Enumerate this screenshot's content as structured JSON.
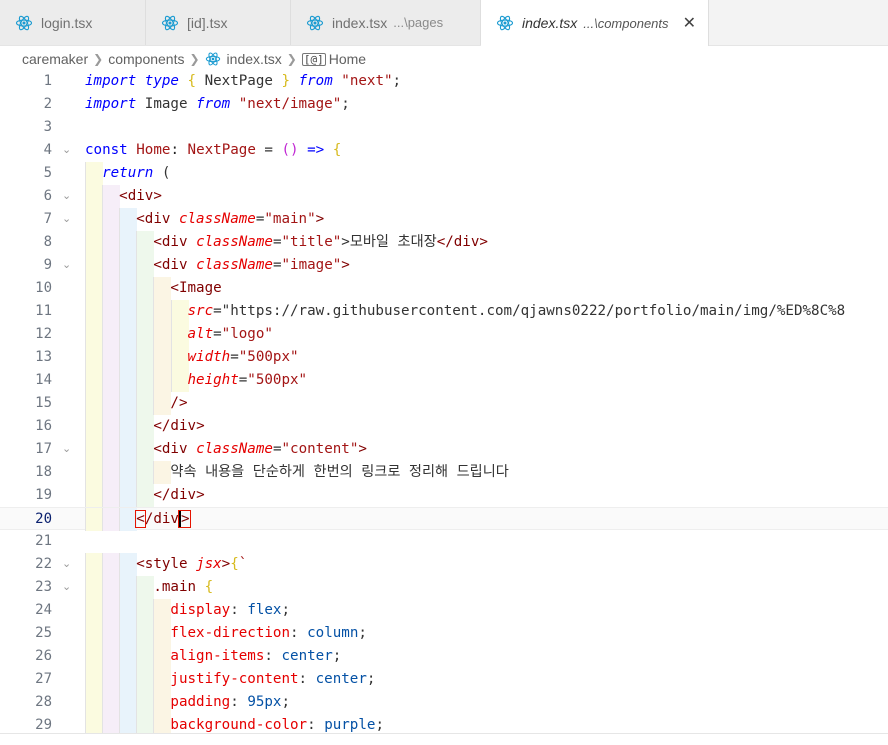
{
  "tabs": [
    {
      "name": "login.tsx",
      "hint": ""
    },
    {
      "name": "[id].tsx",
      "hint": ""
    },
    {
      "name": "index.tsx",
      "hint": "...\\pages"
    },
    {
      "name": "index.tsx",
      "hint": "...\\components",
      "active": true
    }
  ],
  "breadcrumb": {
    "items": [
      "caremaker",
      "components",
      "index.tsx",
      "Home"
    ]
  },
  "icons": {
    "tab_file_icon": "react-icon",
    "breadcrumb_symbol_icon": "symbol-variable-icon",
    "close": "close-icon"
  },
  "colors": {
    "keyword": "#0000ff",
    "string": "#a31515",
    "tag": "#800000",
    "attribute": "#e50000",
    "react_icon": "#1b9bd1"
  },
  "editor": {
    "current_line": 20,
    "lines": [
      {
        "n": "1",
        "text": "import type { NextPage } from \"next\";"
      },
      {
        "n": "2",
        "text": "import Image from \"next/image\";"
      },
      {
        "n": "3",
        "text": ""
      },
      {
        "n": "4",
        "text": "const Home: NextPage = () => {"
      },
      {
        "n": "5",
        "text": "  return ("
      },
      {
        "n": "6",
        "text": "    <div>"
      },
      {
        "n": "7",
        "text": "      <div className=\"main\">"
      },
      {
        "n": "8",
        "text": "        <div className=\"title\">모바일 초대장</div>"
      },
      {
        "n": "9",
        "text": "        <div className=\"image\">"
      },
      {
        "n": "10",
        "text": "          <Image"
      },
      {
        "n": "11",
        "text": "            src=\"https://raw.githubusercontent.com/qjawns0222/portfolio/main/img/%ED%8C%8"
      },
      {
        "n": "12",
        "text": "            alt=\"logo\""
      },
      {
        "n": "13",
        "text": "            width=\"500px\""
      },
      {
        "n": "14",
        "text": "            height=\"500px\""
      },
      {
        "n": "15",
        "text": "          />"
      },
      {
        "n": "16",
        "text": "        </div>"
      },
      {
        "n": "17",
        "text": "        <div className=\"content\">"
      },
      {
        "n": "18",
        "text": "          약속 내용을 단순하게 한번의 링크로 정리해 드립니다"
      },
      {
        "n": "19",
        "text": "        </div>"
      },
      {
        "n": "20",
        "text": "      </div>"
      },
      {
        "n": "21",
        "text": ""
      },
      {
        "n": "22",
        "text": "      <style jsx>{`"
      },
      {
        "n": "23",
        "text": "        .main {"
      },
      {
        "n": "24",
        "text": "          display: flex;"
      },
      {
        "n": "25",
        "text": "          flex-direction: column;"
      },
      {
        "n": "26",
        "text": "          align-items: center;"
      },
      {
        "n": "27",
        "text": "          justify-content: center;"
      },
      {
        "n": "28",
        "text": "          padding: 95px;"
      },
      {
        "n": "29",
        "text": "          background-color: purple;"
      }
    ]
  }
}
